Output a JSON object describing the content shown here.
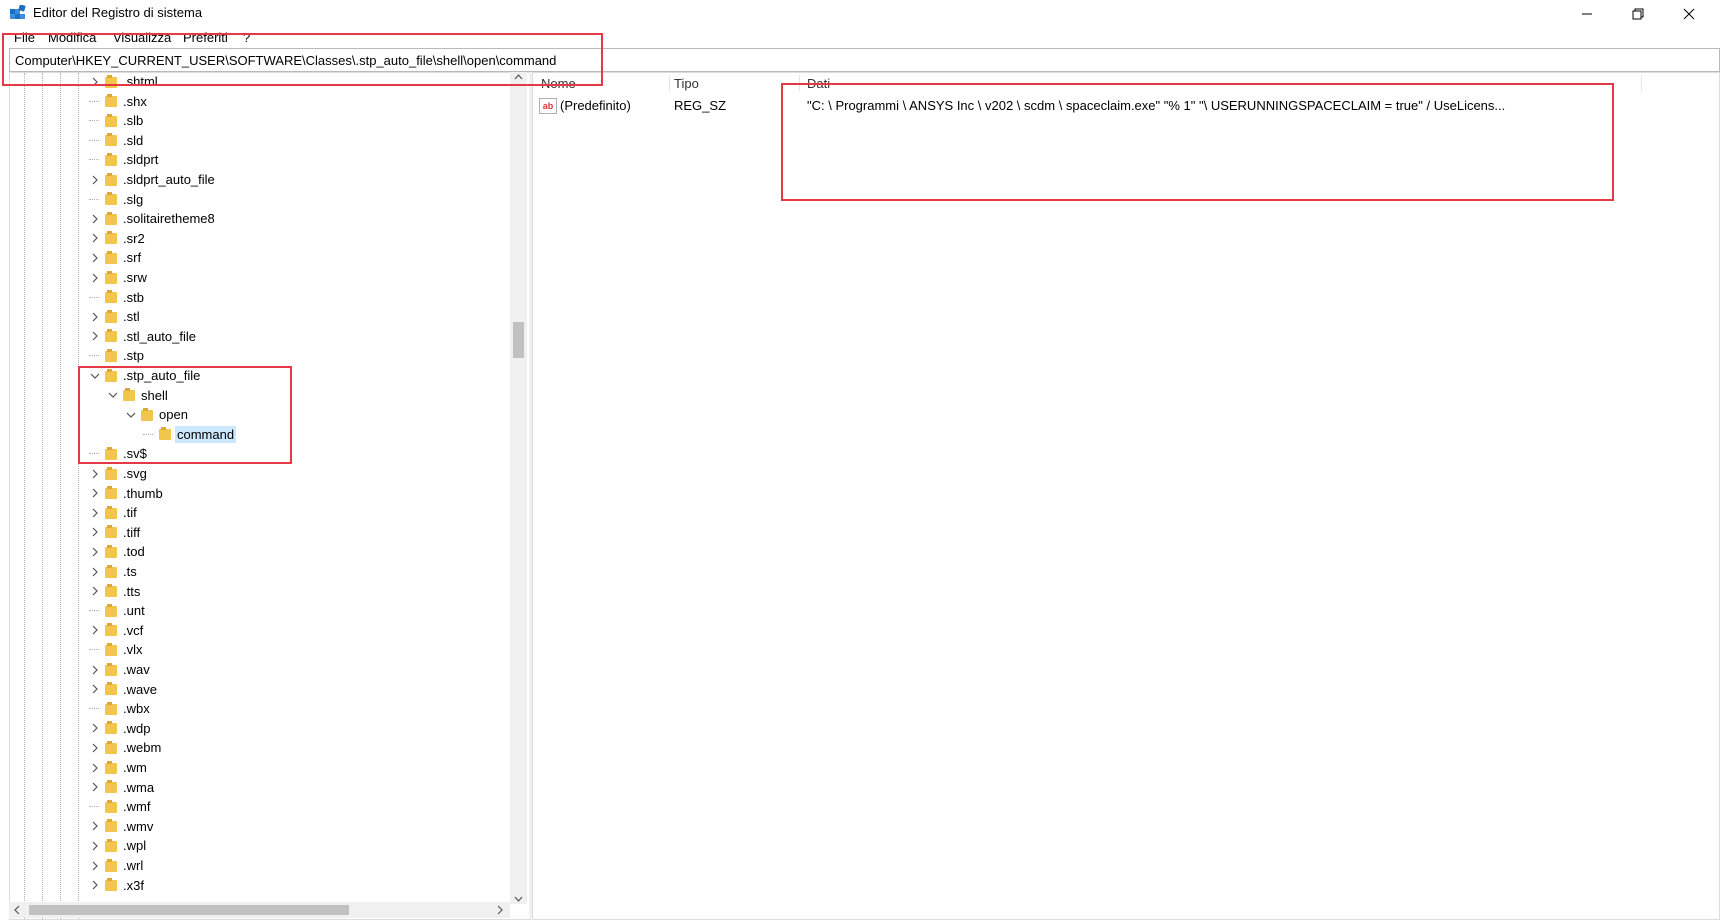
{
  "window": {
    "title": "Editor del Registro di sistema"
  },
  "menu": [
    "File",
    "Modifica",
    "Visualizza",
    "Preferiti",
    "?"
  ],
  "address": "Computer\\HKEY_CURRENT_USER\\SOFTWARE\\Classes\\.stp_auto_file\\shell\\open\\command",
  "tree": [
    {
      "label": ".shtml",
      "expander": ">",
      "depth": 0
    },
    {
      "label": ".shx",
      "expander": "",
      "depth": 0
    },
    {
      "label": ".slb",
      "expander": "",
      "depth": 0
    },
    {
      "label": ".sld",
      "expander": "",
      "depth": 0
    },
    {
      "label": ".sldprt",
      "expander": "",
      "depth": 0
    },
    {
      "label": ".sldprt_auto_file",
      "expander": ">",
      "depth": 0
    },
    {
      "label": ".slg",
      "expander": "",
      "depth": 0
    },
    {
      "label": ".solitairetheme8",
      "expander": ">",
      "depth": 0
    },
    {
      "label": ".sr2",
      "expander": ">",
      "depth": 0
    },
    {
      "label": ".srf",
      "expander": ">",
      "depth": 0
    },
    {
      "label": ".srw",
      "expander": ">",
      "depth": 0
    },
    {
      "label": ".stb",
      "expander": "",
      "depth": 0
    },
    {
      "label": ".stl",
      "expander": ">",
      "depth": 0
    },
    {
      "label": ".stl_auto_file",
      "expander": ">",
      "depth": 0
    },
    {
      "label": ".stp",
      "expander": "",
      "depth": 0
    },
    {
      "label": ".stp_auto_file",
      "expander": "v",
      "depth": 0
    },
    {
      "label": "shell",
      "expander": "v",
      "depth": 1
    },
    {
      "label": "open",
      "expander": "v",
      "depth": 2
    },
    {
      "label": "command",
      "expander": "",
      "depth": 3,
      "selected": true
    },
    {
      "label": ".sv$",
      "expander": "",
      "depth": 0
    },
    {
      "label": ".svg",
      "expander": ">",
      "depth": 0
    },
    {
      "label": ".thumb",
      "expander": ">",
      "depth": 0
    },
    {
      "label": ".tif",
      "expander": ">",
      "depth": 0
    },
    {
      "label": ".tiff",
      "expander": ">",
      "depth": 0
    },
    {
      "label": ".tod",
      "expander": ">",
      "depth": 0
    },
    {
      "label": ".ts",
      "expander": ">",
      "depth": 0
    },
    {
      "label": ".tts",
      "expander": ">",
      "depth": 0
    },
    {
      "label": ".unt",
      "expander": "",
      "depth": 0
    },
    {
      "label": ".vcf",
      "expander": ">",
      "depth": 0
    },
    {
      "label": ".vlx",
      "expander": "",
      "depth": 0
    },
    {
      "label": ".wav",
      "expander": ">",
      "depth": 0
    },
    {
      "label": ".wave",
      "expander": ">",
      "depth": 0
    },
    {
      "label": ".wbx",
      "expander": "",
      "depth": 0
    },
    {
      "label": ".wdp",
      "expander": ">",
      "depth": 0
    },
    {
      "label": ".webm",
      "expander": ">",
      "depth": 0
    },
    {
      "label": ".wm",
      "expander": ">",
      "depth": 0
    },
    {
      "label": ".wma",
      "expander": ">",
      "depth": 0
    },
    {
      "label": ".wmf",
      "expander": "",
      "depth": 0
    },
    {
      "label": ".wmv",
      "expander": ">",
      "depth": 0
    },
    {
      "label": ".wpl",
      "expander": ">",
      "depth": 0
    },
    {
      "label": ".wrl",
      "expander": ">",
      "depth": 0
    },
    {
      "label": ".x3f",
      "expander": ">",
      "depth": 0
    }
  ],
  "list": {
    "columns": [
      "Nome",
      "Tipo",
      "Dati"
    ],
    "rows": [
      {
        "icon": "ab",
        "name": "(Predefinito)",
        "type": "REG_SZ",
        "data": "\"C: \\ Programmi \\ ANSYS Inc \\ v202 \\ scdm \\ spaceclaim.exe\" \"% 1\" \"\\ USERUNNINGSPACECLAIM = true\" / UseLicens..."
      }
    ]
  },
  "colors": {
    "highlight": "#e53a45",
    "selection": "#cce8ff",
    "folder": "#f2c54d"
  }
}
